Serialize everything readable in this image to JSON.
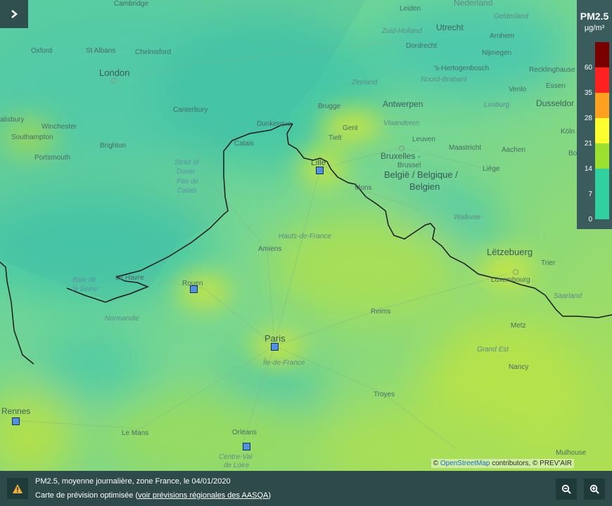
{
  "legend": {
    "title": "PM2.5",
    "unit": "µg/m³",
    "thresholds": [
      "60",
      "35",
      "28",
      "21",
      "14",
      "7",
      "0"
    ],
    "colors": [
      "#7a0000",
      "#ff2020",
      "#ffa020",
      "#ffff30",
      "#9ce030",
      "#30d0a0"
    ]
  },
  "map": {
    "cities": {
      "cambridge": "Cambridge",
      "leiden": "Leiden",
      "nederland": "Nederland",
      "gelderland": "Gelderland",
      "zuid_holland": "Zuid-Holland",
      "utrecht": "Utrecht",
      "arnhem": "Arnhem",
      "oxford": "Oxford",
      "st_albans": "St Albans",
      "chelmsford": "Chelmsford",
      "dordrecht": "Dordrecht",
      "nijmegen": "Nijmegen",
      "london": "London",
      "s_hertogenbosch": "'s-Hertogenbosch",
      "recklinghausen": "Recklinghause",
      "zeeland": "Zeeland",
      "noord_brabant": "Noord-Brabant",
      "essen": "Essen",
      "venlo": "Venlo",
      "canterbury": "Canterbury",
      "brugge": "Brugge",
      "antwerpen": "Antwerpen",
      "limburg": "Limburg",
      "dusseldorf": "Dusseldor",
      "alisbury": "alisbury",
      "winchester": "Winchester",
      "dunkerque": "Dunkerque",
      "gent": "Gent",
      "vlaanderen": "Vlaanderen",
      "koln": "Köln",
      "southampton": "Southampton",
      "brighton": "Brighton",
      "calais": "Calais",
      "tielt": "Tielt",
      "leuven": "Leuven",
      "bruxelles": "Bruxelles -",
      "brussel": "Brussel",
      "portsmouth": "Portsmouth",
      "maastricht": "Maastricht",
      "aachen": "Aachen",
      "bonn": "Bonn",
      "lille": "Lille",
      "liege": "Liège",
      "belgie1": "België / Belgique /",
      "belgie2": "Belgien",
      "mons": "Mons",
      "wallonie": "Wallonie",
      "hauts_de_france": "Hauts-de-France",
      "amiens": "Amiens",
      "letzebuerg": "Lëtzebuerg",
      "trier": "Trier",
      "le_havre": "Le Havre",
      "luxembourg": "Luxembourg",
      "rouen": "Rouen",
      "saarland": "Saarland",
      "normandie": "Normandie",
      "reims": "Reims",
      "metz": "Metz",
      "paris": "Paris",
      "grand_est": "Grand Est",
      "ile_de_france": "Île-de-France",
      "nancy": "Nancy",
      "rennes": "Rennes",
      "troyes": "Troyes",
      "le_mans": "Le Mans",
      "orleans": "Orléans",
      "centre_val1": "Centre-Val",
      "centre_val2": "de Loire",
      "mulhouse": "Mulhouse"
    },
    "water": {
      "strait1": "Strait of",
      "strait2": "Dover",
      "strait3": "Pas de",
      "strait4": "Calais",
      "seine1": "Baie de",
      "seine2": "la Seine"
    }
  },
  "attribution": {
    "prefix": "©",
    "osm_link": "OpenStreetMap",
    "rest": "contributors, © PREV'AIR"
  },
  "footer": {
    "line1": "PM2.5, moyenne journalière, zone France, le 04/01/2020",
    "line2_prefix": "Carte de prévision optimisée (",
    "line2_link": "voir prévisions régionales des AASQA",
    "line2_suffix": ")"
  },
  "icons": {
    "toggle": "chevron-right-icon",
    "warning": "warning-icon",
    "zoom_out": "zoom-out-icon",
    "zoom_in": "zoom-in-icon"
  }
}
